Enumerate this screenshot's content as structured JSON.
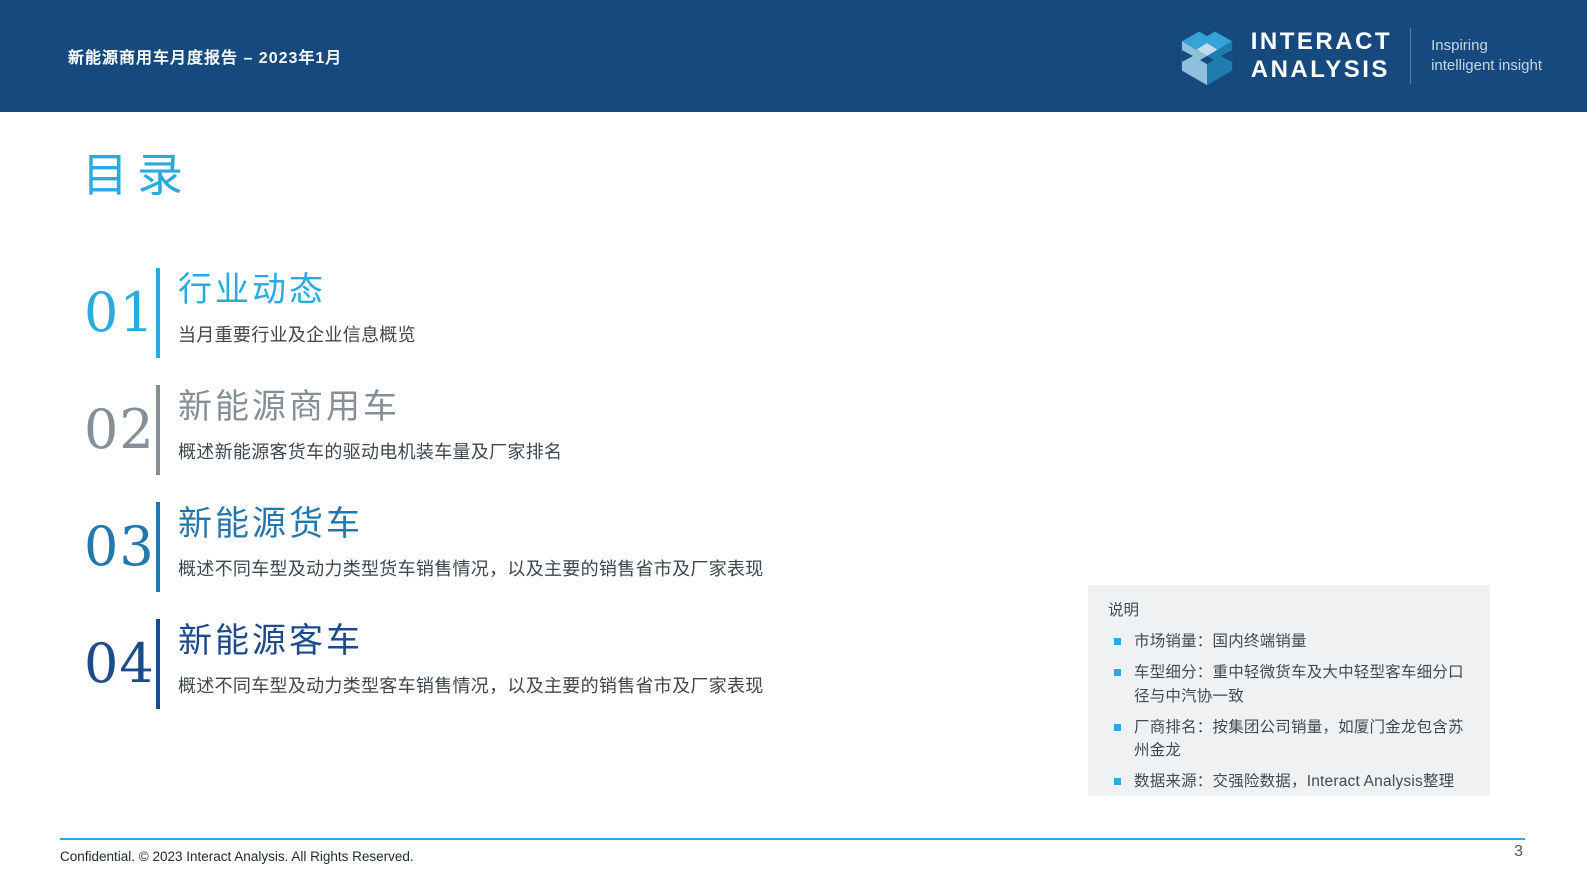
{
  "header": {
    "report_title": "新能源商用车月度报告 – 2023年1月",
    "logo": {
      "wordmark_line1": "INTERACT",
      "wordmark_line2": "ANALYSIS",
      "tagline_line1": "Inspiring",
      "tagline_line2": "intelligent insight"
    }
  },
  "page": {
    "title": "目录",
    "page_number": "3",
    "footer_text": "Confidential. © 2023 Interact Analysis. All Rights Reserved."
  },
  "toc": {
    "items": [
      {
        "number": "01",
        "title": "行业动态",
        "subtitle": "当月重要行业及企业信息概览",
        "color": "#29abe2"
      },
      {
        "number": "02",
        "title": "新能源商用车",
        "subtitle": "概述新能源客货车的驱动电机装车量及厂家排名",
        "color": "#868f97"
      },
      {
        "number": "03",
        "title": "新能源货车",
        "subtitle": "概述不同车型及动力类型货车销售情况，以及主要的销售省市及厂家表现",
        "color": "#2377ad"
      },
      {
        "number": "04",
        "title": "新能源客车",
        "subtitle": "概述不同车型及动力类型客车销售情况，以及主要的销售省市及厂家表现",
        "color": "#1c4b8c"
      }
    ]
  },
  "notes": {
    "heading": "说明",
    "items": [
      "市场销量：国内终端销量",
      "车型细分：重中轻微货车及大中轻型客车细分口径与中汽协一致",
      "厂商排名：按集团公司销量，如厦门金龙包含苏州金龙",
      "数据来源：交强险数据，Interact Analysis整理"
    ],
    "bullet_color": "#29abe2"
  },
  "colors": {
    "header_bg": "#164a7e",
    "accent_cyan": "#29abe2"
  }
}
